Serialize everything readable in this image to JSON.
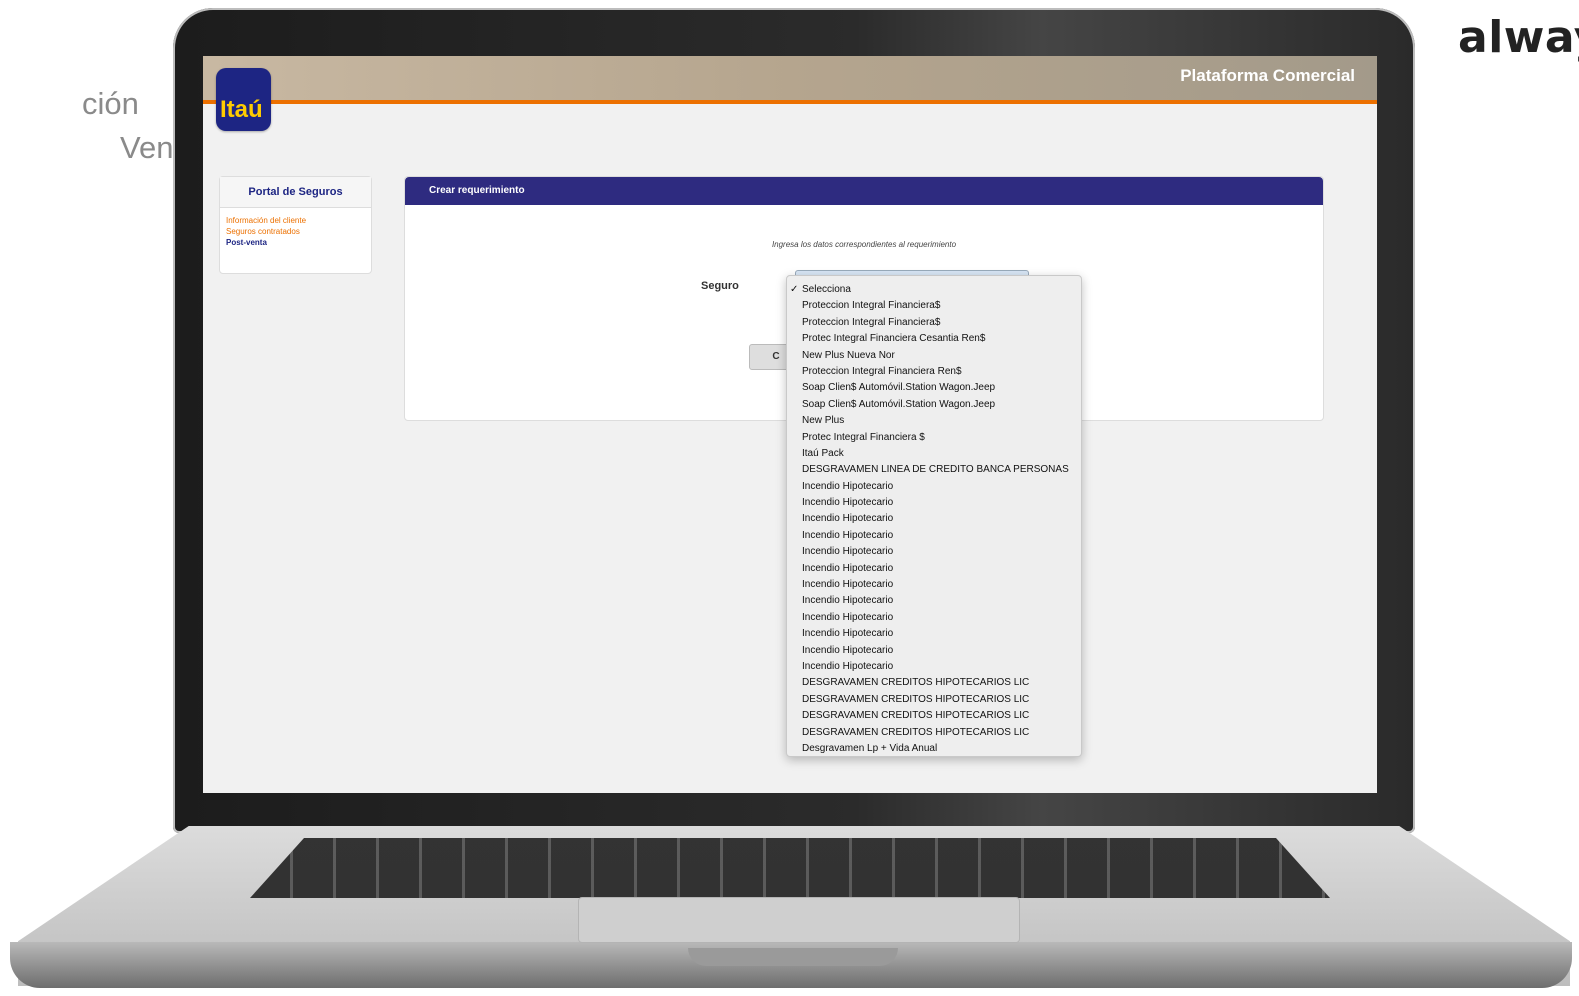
{
  "side_text": {
    "line1": "ción",
    "line2": "Venta",
    "brand": "alway"
  },
  "app": {
    "platform_title": "Plataforma Comercial",
    "logo_text": "Itaú"
  },
  "sidebar": {
    "title": "Portal de Seguros",
    "items": [
      {
        "label": "Información del cliente"
      },
      {
        "label": "Seguros contratados"
      },
      {
        "label": "Post-venta"
      }
    ]
  },
  "panel": {
    "title": "Crear requerimiento",
    "instruction": "Ingresa los datos correspondientes al requerimiento",
    "seguro_label": "Seguro",
    "button_label": "C"
  },
  "dropdown": {
    "checkmark": "✓",
    "options": [
      {
        "label": "Selecciona",
        "selected": true
      },
      {
        "label": "Proteccion Integral Financiera$"
      },
      {
        "label": "Proteccion Integral Financiera$"
      },
      {
        "label": "Protec Integral Financiera Cesantia Ren$"
      },
      {
        "label": "New Plus Nueva Nor"
      },
      {
        "label": "Proteccion Integral Financiera Ren$"
      },
      {
        "label": "Soap Clien$ Automóvil.Station Wagon.Jeep"
      },
      {
        "label": "Soap Clien$ Automóvil.Station Wagon.Jeep"
      },
      {
        "label": "New Plus"
      },
      {
        "label": "Protec Integral Financiera $"
      },
      {
        "label": "Itaú Pack"
      },
      {
        "label": "DESGRAVAMEN LINEA DE CREDITO BANCA PERSONAS"
      },
      {
        "label": "Incendio Hipotecario"
      },
      {
        "label": "Incendio Hipotecario"
      },
      {
        "label": "Incendio Hipotecario"
      },
      {
        "label": "Incendio Hipotecario"
      },
      {
        "label": "Incendio Hipotecario"
      },
      {
        "label": "Incendio Hipotecario"
      },
      {
        "label": "Incendio Hipotecario"
      },
      {
        "label": "Incendio Hipotecario"
      },
      {
        "label": "Incendio Hipotecario"
      },
      {
        "label": "Incendio Hipotecario"
      },
      {
        "label": "Incendio Hipotecario"
      },
      {
        "label": "Incendio Hipotecario"
      },
      {
        "label": "DESGRAVAMEN CREDITOS HIPOTECARIOS LIC"
      },
      {
        "label": "DESGRAVAMEN CREDITOS HIPOTECARIOS LIC"
      },
      {
        "label": "DESGRAVAMEN CREDITOS HIPOTECARIOS LIC"
      },
      {
        "label": "DESGRAVAMEN CREDITOS HIPOTECARIOS LIC"
      },
      {
        "label": "Desgravamen Lp + Vida Anual"
      }
    ]
  },
  "colors": {
    "brand_blue": "#1d2583",
    "accent_orange": "#ec7000",
    "header_bar": "#2e2b80"
  }
}
